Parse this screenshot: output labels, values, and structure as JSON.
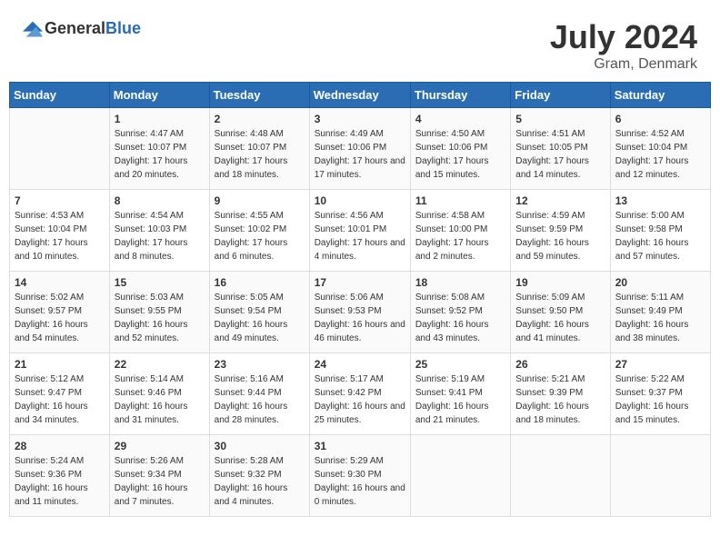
{
  "header": {
    "logo_general": "General",
    "logo_blue": "Blue",
    "title": "July 2024",
    "location": "Gram, Denmark"
  },
  "days_of_week": [
    "Sunday",
    "Monday",
    "Tuesday",
    "Wednesday",
    "Thursday",
    "Friday",
    "Saturday"
  ],
  "weeks": [
    [
      {
        "day": "",
        "sunrise": "",
        "sunset": "",
        "daylight": ""
      },
      {
        "day": "1",
        "sunrise": "Sunrise: 4:47 AM",
        "sunset": "Sunset: 10:07 PM",
        "daylight": "Daylight: 17 hours and 20 minutes."
      },
      {
        "day": "2",
        "sunrise": "Sunrise: 4:48 AM",
        "sunset": "Sunset: 10:07 PM",
        "daylight": "Daylight: 17 hours and 18 minutes."
      },
      {
        "day": "3",
        "sunrise": "Sunrise: 4:49 AM",
        "sunset": "Sunset: 10:06 PM",
        "daylight": "Daylight: 17 hours and 17 minutes."
      },
      {
        "day": "4",
        "sunrise": "Sunrise: 4:50 AM",
        "sunset": "Sunset: 10:06 PM",
        "daylight": "Daylight: 17 hours and 15 minutes."
      },
      {
        "day": "5",
        "sunrise": "Sunrise: 4:51 AM",
        "sunset": "Sunset: 10:05 PM",
        "daylight": "Daylight: 17 hours and 14 minutes."
      },
      {
        "day": "6",
        "sunrise": "Sunrise: 4:52 AM",
        "sunset": "Sunset: 10:04 PM",
        "daylight": "Daylight: 17 hours and 12 minutes."
      }
    ],
    [
      {
        "day": "7",
        "sunrise": "Sunrise: 4:53 AM",
        "sunset": "Sunset: 10:04 PM",
        "daylight": "Daylight: 17 hours and 10 minutes."
      },
      {
        "day": "8",
        "sunrise": "Sunrise: 4:54 AM",
        "sunset": "Sunset: 10:03 PM",
        "daylight": "Daylight: 17 hours and 8 minutes."
      },
      {
        "day": "9",
        "sunrise": "Sunrise: 4:55 AM",
        "sunset": "Sunset: 10:02 PM",
        "daylight": "Daylight: 17 hours and 6 minutes."
      },
      {
        "day": "10",
        "sunrise": "Sunrise: 4:56 AM",
        "sunset": "Sunset: 10:01 PM",
        "daylight": "Daylight: 17 hours and 4 minutes."
      },
      {
        "day": "11",
        "sunrise": "Sunrise: 4:58 AM",
        "sunset": "Sunset: 10:00 PM",
        "daylight": "Daylight: 17 hours and 2 minutes."
      },
      {
        "day": "12",
        "sunrise": "Sunrise: 4:59 AM",
        "sunset": "Sunset: 9:59 PM",
        "daylight": "Daylight: 16 hours and 59 minutes."
      },
      {
        "day": "13",
        "sunrise": "Sunrise: 5:00 AM",
        "sunset": "Sunset: 9:58 PM",
        "daylight": "Daylight: 16 hours and 57 minutes."
      }
    ],
    [
      {
        "day": "14",
        "sunrise": "Sunrise: 5:02 AM",
        "sunset": "Sunset: 9:57 PM",
        "daylight": "Daylight: 16 hours and 54 minutes."
      },
      {
        "day": "15",
        "sunrise": "Sunrise: 5:03 AM",
        "sunset": "Sunset: 9:55 PM",
        "daylight": "Daylight: 16 hours and 52 minutes."
      },
      {
        "day": "16",
        "sunrise": "Sunrise: 5:05 AM",
        "sunset": "Sunset: 9:54 PM",
        "daylight": "Daylight: 16 hours and 49 minutes."
      },
      {
        "day": "17",
        "sunrise": "Sunrise: 5:06 AM",
        "sunset": "Sunset: 9:53 PM",
        "daylight": "Daylight: 16 hours and 46 minutes."
      },
      {
        "day": "18",
        "sunrise": "Sunrise: 5:08 AM",
        "sunset": "Sunset: 9:52 PM",
        "daylight": "Daylight: 16 hours and 43 minutes."
      },
      {
        "day": "19",
        "sunrise": "Sunrise: 5:09 AM",
        "sunset": "Sunset: 9:50 PM",
        "daylight": "Daylight: 16 hours and 41 minutes."
      },
      {
        "day": "20",
        "sunrise": "Sunrise: 5:11 AM",
        "sunset": "Sunset: 9:49 PM",
        "daylight": "Daylight: 16 hours and 38 minutes."
      }
    ],
    [
      {
        "day": "21",
        "sunrise": "Sunrise: 5:12 AM",
        "sunset": "Sunset: 9:47 PM",
        "daylight": "Daylight: 16 hours and 34 minutes."
      },
      {
        "day": "22",
        "sunrise": "Sunrise: 5:14 AM",
        "sunset": "Sunset: 9:46 PM",
        "daylight": "Daylight: 16 hours and 31 minutes."
      },
      {
        "day": "23",
        "sunrise": "Sunrise: 5:16 AM",
        "sunset": "Sunset: 9:44 PM",
        "daylight": "Daylight: 16 hours and 28 minutes."
      },
      {
        "day": "24",
        "sunrise": "Sunrise: 5:17 AM",
        "sunset": "Sunset: 9:42 PM",
        "daylight": "Daylight: 16 hours and 25 minutes."
      },
      {
        "day": "25",
        "sunrise": "Sunrise: 5:19 AM",
        "sunset": "Sunset: 9:41 PM",
        "daylight": "Daylight: 16 hours and 21 minutes."
      },
      {
        "day": "26",
        "sunrise": "Sunrise: 5:21 AM",
        "sunset": "Sunset: 9:39 PM",
        "daylight": "Daylight: 16 hours and 18 minutes."
      },
      {
        "day": "27",
        "sunrise": "Sunrise: 5:22 AM",
        "sunset": "Sunset: 9:37 PM",
        "daylight": "Daylight: 16 hours and 15 minutes."
      }
    ],
    [
      {
        "day": "28",
        "sunrise": "Sunrise: 5:24 AM",
        "sunset": "Sunset: 9:36 PM",
        "daylight": "Daylight: 16 hours and 11 minutes."
      },
      {
        "day": "29",
        "sunrise": "Sunrise: 5:26 AM",
        "sunset": "Sunset: 9:34 PM",
        "daylight": "Daylight: 16 hours and 7 minutes."
      },
      {
        "day": "30",
        "sunrise": "Sunrise: 5:28 AM",
        "sunset": "Sunset: 9:32 PM",
        "daylight": "Daylight: 16 hours and 4 minutes."
      },
      {
        "day": "31",
        "sunrise": "Sunrise: 5:29 AM",
        "sunset": "Sunset: 9:30 PM",
        "daylight": "Daylight: 16 hours and 0 minutes."
      },
      {
        "day": "",
        "sunrise": "",
        "sunset": "",
        "daylight": ""
      },
      {
        "day": "",
        "sunrise": "",
        "sunset": "",
        "daylight": ""
      },
      {
        "day": "",
        "sunrise": "",
        "sunset": "",
        "daylight": ""
      }
    ]
  ]
}
